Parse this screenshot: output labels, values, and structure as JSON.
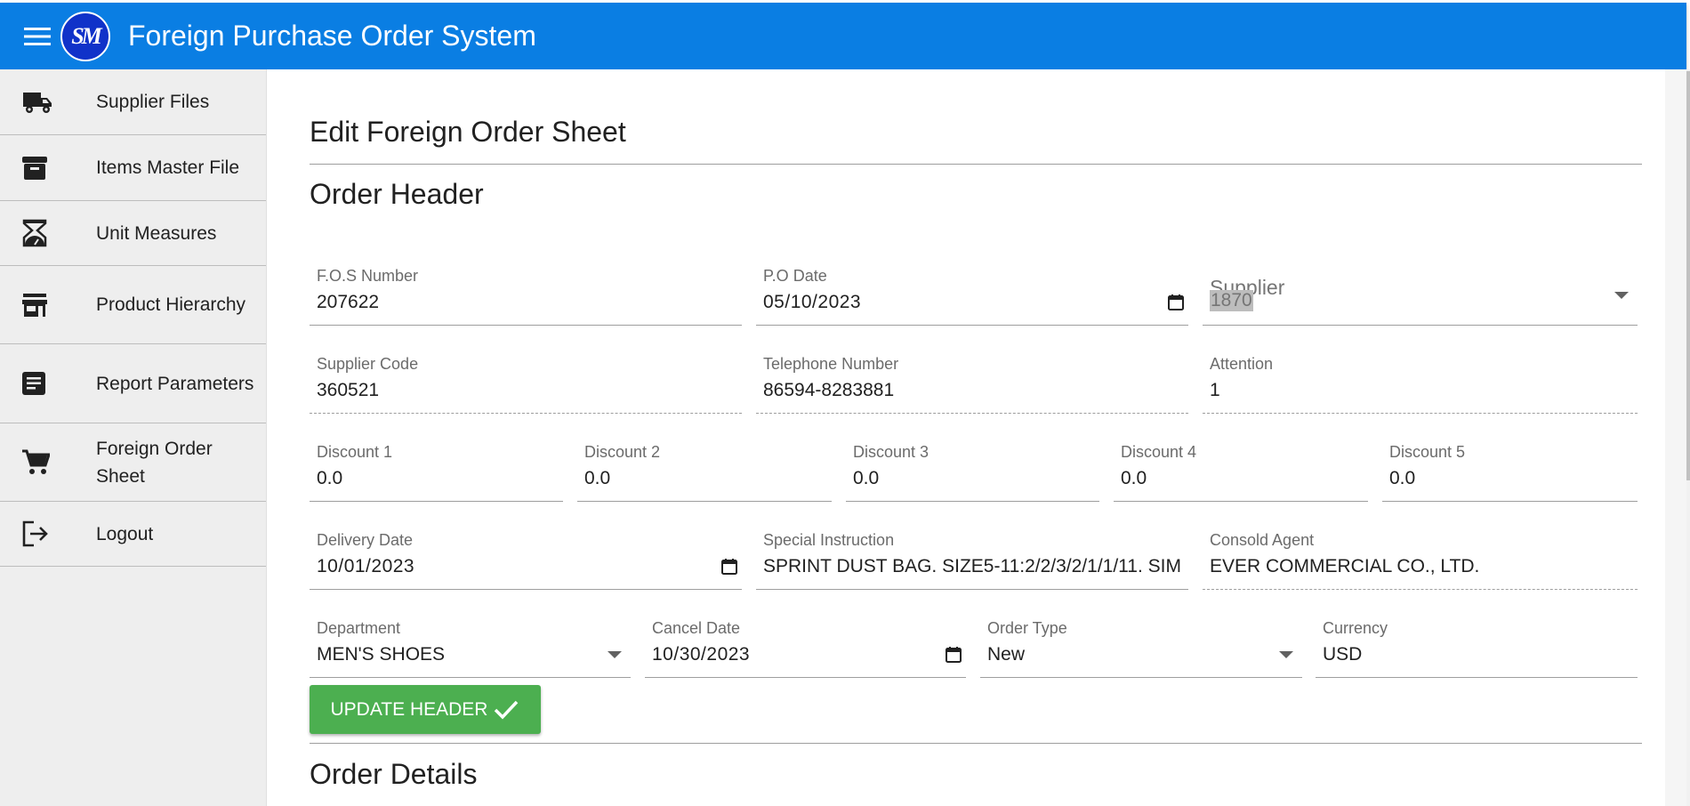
{
  "app": {
    "title": "Foreign Purchase Order System",
    "logo_text": "SM",
    "brand_color": "#0a7ee3",
    "logo_color": "#1032c9"
  },
  "sidebar": {
    "items": [
      {
        "label": "Supplier Files",
        "icon": "truck-icon"
      },
      {
        "label": "Items Master File",
        "icon": "archive-icon"
      },
      {
        "label": "Unit Measures",
        "icon": "scale-icon"
      },
      {
        "label": "Product Hierarchy",
        "icon": "store-icon"
      },
      {
        "label": "Report Parameters",
        "icon": "document-icon"
      },
      {
        "label": "Foreign Order Sheet",
        "icon": "cart-icon"
      },
      {
        "label": "Logout",
        "icon": "logout-icon"
      }
    ]
  },
  "main": {
    "page_title": "Edit Foreign Order Sheet",
    "order_header_title": "Order Header",
    "order_details_title": "Order Details",
    "fields": {
      "fos_number": {
        "label": "F.O.S Number",
        "value": "207622"
      },
      "po_date": {
        "label": "P.O Date",
        "value": "05/10/2023"
      },
      "supplier": {
        "label": "Supplier",
        "value": "1870"
      },
      "supplier_code": {
        "label": "Supplier Code",
        "value": "360521"
      },
      "telephone": {
        "label": "Telephone Number",
        "value": "86594-8283881"
      },
      "attention": {
        "label": "Attention",
        "value": "1"
      },
      "discount1": {
        "label": "Discount 1",
        "value": "0.0"
      },
      "discount2": {
        "label": "Discount 2",
        "value": "0.0"
      },
      "discount3": {
        "label": "Discount 3",
        "value": "0.0"
      },
      "discount4": {
        "label": "Discount 4",
        "value": "0.0"
      },
      "discount5": {
        "label": "Discount 5",
        "value": "0.0"
      },
      "delivery_date": {
        "label": "Delivery Date",
        "value": "10/01/2023"
      },
      "special_instruction": {
        "label": "Special Instruction",
        "value": "SPRINT DUST BAG. SIZE5-11:2/2/3/2/1/1/11. SIM"
      },
      "consold_agent": {
        "label": "Consold Agent",
        "value": "EVER COMMERCIAL CO., LTD."
      },
      "department": {
        "label": "Department",
        "value": "MEN'S SHOES"
      },
      "cancel_date": {
        "label": "Cancel Date",
        "value": "10/30/2023"
      },
      "order_type": {
        "label": "Order Type",
        "value": "New"
      },
      "currency": {
        "label": "Currency",
        "value": "USD"
      }
    },
    "update_button_label": "UPDATE HEADER",
    "button_color": "#4caf50"
  }
}
